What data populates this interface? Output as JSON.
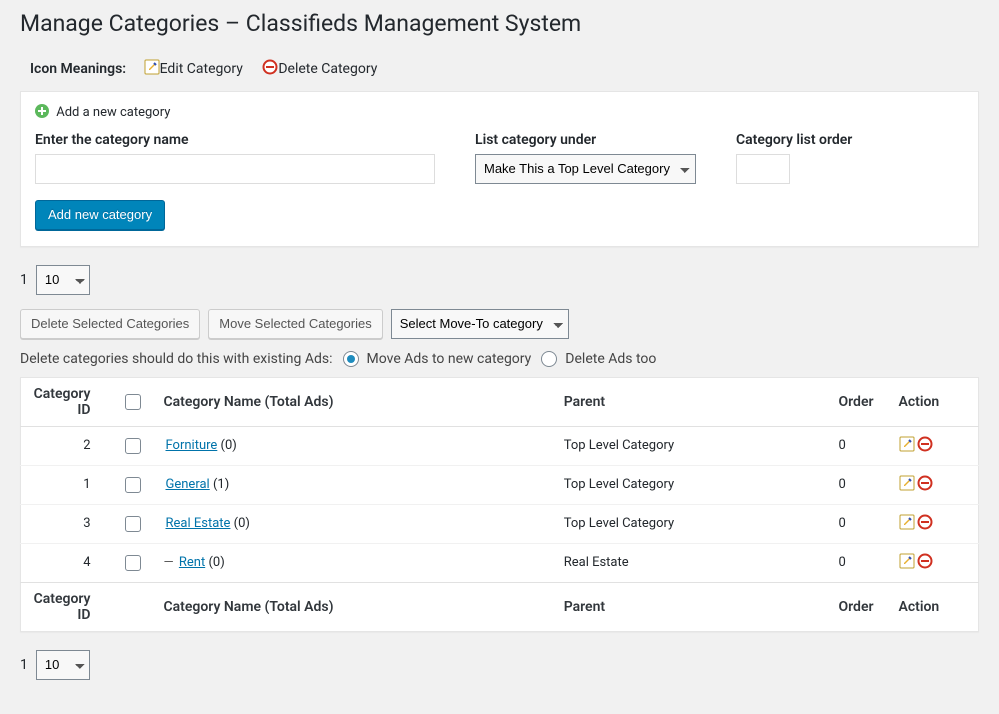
{
  "page_title": "Manage Categories – Classifieds Management System",
  "legend": {
    "label": "Icon Meanings:",
    "edit": "Edit Category",
    "delete": "Delete Category"
  },
  "add_panel": {
    "title": "Add a new category",
    "name_label": "Enter the category name",
    "parent_label": "List category under",
    "parent_option": "Make This a Top Level Category",
    "order_label": "Category list order",
    "button": "Add new category"
  },
  "pager": {
    "page": "1",
    "per_page": "10"
  },
  "bulk": {
    "delete_btn": "Delete Selected Categories",
    "move_btn": "Move Selected Categories",
    "move_to_option": "Select Move-To category"
  },
  "delete_behavior": {
    "prompt": "Delete categories should do this with existing Ads:",
    "opt_move": "Move Ads to new category",
    "opt_delete": "Delete Ads too"
  },
  "columns": {
    "id": "Category ID",
    "name": "Category Name (Total Ads)",
    "parent": "Parent",
    "order": "Order",
    "action": "Action"
  },
  "rows": [
    {
      "id": "2",
      "name": "Forniture",
      "count": "(0)",
      "indent": "",
      "parent": "Top Level Category",
      "order": "0"
    },
    {
      "id": "1",
      "name": "General",
      "count": "(1)",
      "indent": "",
      "parent": "Top Level Category",
      "order": "0"
    },
    {
      "id": "3",
      "name": "Real Estate",
      "count": "(0)",
      "indent": "",
      "parent": "Top Level Category",
      "order": "0"
    },
    {
      "id": "4",
      "name": "Rent",
      "count": "(0)",
      "indent": "— ",
      "parent": "Real Estate",
      "order": "0"
    }
  ]
}
